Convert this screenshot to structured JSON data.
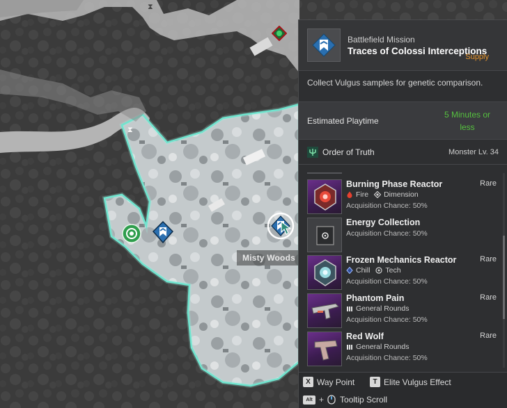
{
  "map": {
    "location_label": "Misty Woods",
    "colors": {
      "zone_outline": "#5fe0c8",
      "zone_fill": "#c9cfd1",
      "river": "#b4b4b4",
      "forest": "#3a3a3a"
    },
    "markers": [
      {
        "name": "battlefield-mission-marker",
        "icon": "chevron-flag-icon",
        "color": "#2a6fb0"
      },
      {
        "name": "selected-mission-marker",
        "icon": "chevron-flag-icon",
        "color": "#2a6fb0"
      },
      {
        "name": "outpost-marker",
        "icon": "target-ring-icon",
        "color": "#2e9d4c"
      },
      {
        "name": "vulgus-marker",
        "icon": "diamond-icon",
        "color": "#2e9d4c"
      }
    ]
  },
  "panel": {
    "mission_type": "Battlefield Mission",
    "mission_name": "Traces of Colossi Interceptions",
    "mission_tag": "Supply",
    "description": "Collect Vulgus samples for genetic comparison.",
    "playtime_label": "Estimated Playtime",
    "playtime_value": "5 Minutes or less",
    "faction": "Order of Truth",
    "monster_level": "Monster Lv. 34",
    "rewards": [
      {
        "name": "Burning Phase Reactor",
        "grade": "Rare",
        "traits": [
          {
            "icon": "fire-icon",
            "label": "Fire"
          },
          {
            "icon": "dimension-icon",
            "label": "Dimension"
          }
        ],
        "chance": "Acquisition Chance: 50%"
      },
      {
        "name": "Energy Collection",
        "grade": "",
        "traits": [],
        "chance": "Acquisition Chance: 50%"
      },
      {
        "name": "Frozen Mechanics Reactor",
        "grade": "Rare",
        "traits": [
          {
            "icon": "chill-icon",
            "label": "Chill"
          },
          {
            "icon": "tech-icon",
            "label": "Tech"
          }
        ],
        "chance": "Acquisition Chance: 50%"
      },
      {
        "name": "Phantom Pain",
        "grade": "Rare",
        "traits": [
          {
            "icon": "ammo-icon",
            "label": "General Rounds"
          }
        ],
        "chance": "Acquisition Chance: 50%"
      },
      {
        "name": "Red Wolf",
        "grade": "Rare",
        "traits": [
          {
            "icon": "ammo-icon",
            "label": "General Rounds"
          }
        ],
        "chance": "Acquisition Chance: 50%"
      }
    ],
    "footer": {
      "waypoint_key": "X",
      "waypoint_label": "Way Point",
      "elite_key": "T",
      "elite_label": "Elite Vulgus Effect",
      "scroll_key": "Alt",
      "scroll_plus": "+",
      "scroll_label": "Tooltip Scroll"
    }
  }
}
